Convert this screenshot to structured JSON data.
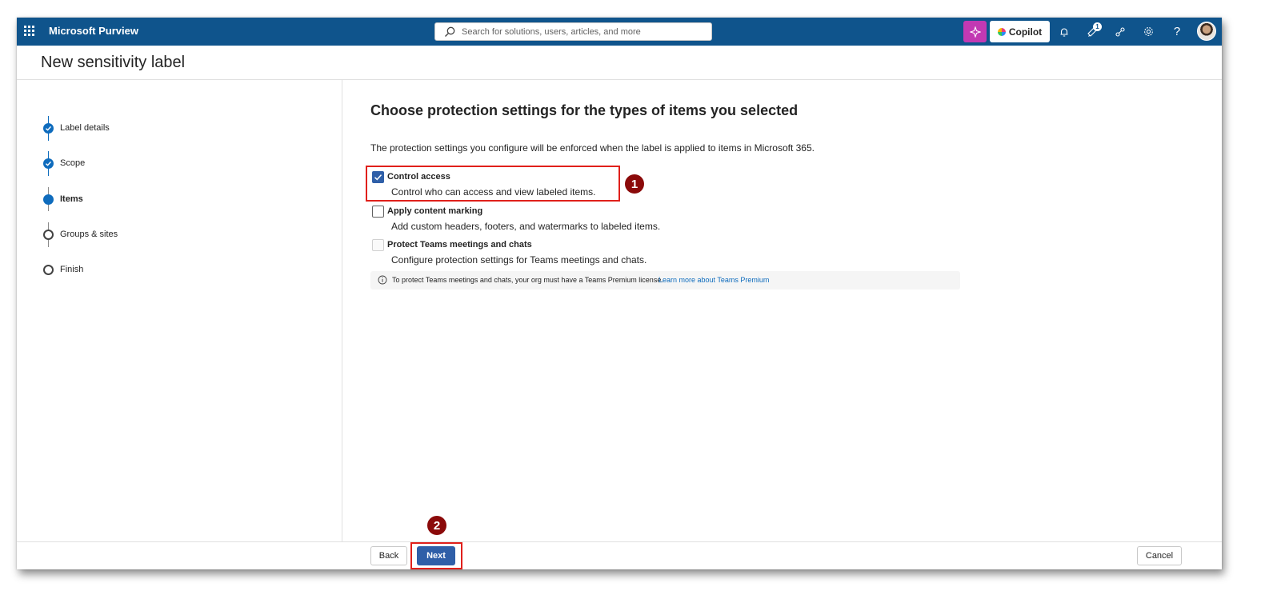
{
  "topbar": {
    "app_title": "Microsoft Purview",
    "search_placeholder": "Search for solutions, users, articles, and more",
    "copilot_label": "Copilot",
    "notification_count": "1"
  },
  "page": {
    "title": "New sensitivity label"
  },
  "stepper": {
    "steps": [
      {
        "label": "Label details",
        "state": "completed"
      },
      {
        "label": "Scope",
        "state": "completed"
      },
      {
        "label": "Items",
        "state": "current"
      },
      {
        "label": "Groups & sites",
        "state": "not-started"
      },
      {
        "label": "Finish",
        "state": "not-started"
      }
    ]
  },
  "main": {
    "heading": "Choose protection settings for the types of items you selected",
    "description": "The protection settings you configure will be enforced when the label is applied to items in Microsoft 365.",
    "options": [
      {
        "label": "Control access",
        "description": "Control who can access and view labeled items.",
        "checked": true,
        "disabled": false
      },
      {
        "label": "Apply content marking",
        "description": "Add custom headers, footers, and watermarks to labeled items.",
        "checked": false,
        "disabled": false
      },
      {
        "label": "Protect Teams meetings and chats",
        "description": "Configure protection settings for Teams meetings and chats.",
        "checked": false,
        "disabled": true
      }
    ],
    "info_text": "To protect Teams meetings and chats, your org must have a Teams Premium license.",
    "info_link": "Learn more about Teams Premium"
  },
  "callouts": {
    "first": "1",
    "second": "2"
  },
  "footer": {
    "back_label": "Back",
    "next_label": "Next",
    "cancel_label": "Cancel"
  },
  "colors": {
    "topbar": "#0f548c",
    "accent": "#0f6cbd",
    "primary_button": "#2f5fa8",
    "callout_box": "#e0201b",
    "callout_badge": "#8b0a0a",
    "pink_button": "#c239b3"
  }
}
